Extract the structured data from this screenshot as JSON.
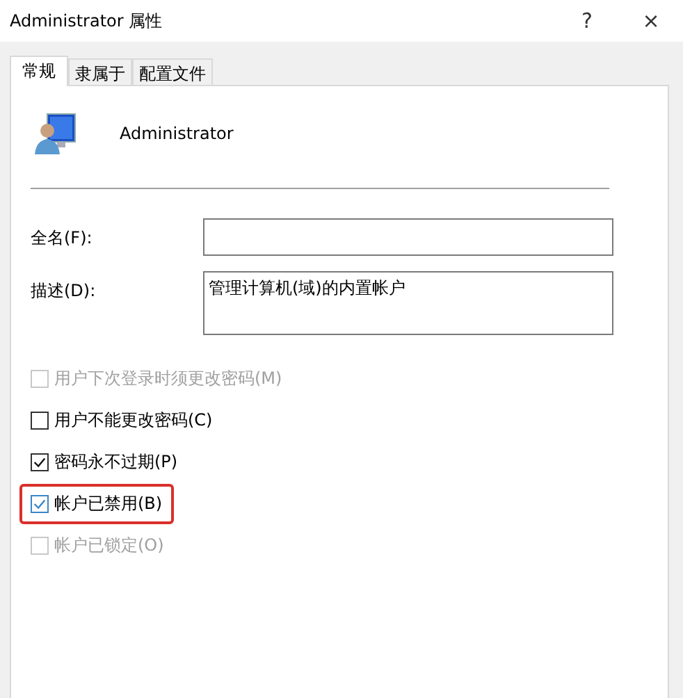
{
  "window": {
    "title": "Administrator 属性",
    "help": "?",
    "close": "×"
  },
  "tabs": [
    {
      "label": "常规",
      "selected": true
    },
    {
      "label": "隶属于",
      "selected": false
    },
    {
      "label": "配置文件",
      "selected": false
    }
  ],
  "user": {
    "name": "Administrator"
  },
  "fields": [
    {
      "label": "全名(F):",
      "multiline": false
    },
    {
      "label": "描述(D):",
      "value": "管理计算机(域)的内置帐户",
      "multiline": true
    }
  ],
  "options": [
    {
      "label": "用户下次登录时须更改密码(M)",
      "checked": false,
      "disabled": true,
      "highlighted": false
    },
    {
      "label": "用户不能更改密码(C)",
      "checked": false,
      "disabled": false,
      "highlighted": false
    },
    {
      "label": "密码永不过期(P)",
      "checked": true,
      "disabled": false,
      "highlighted": false
    },
    {
      "label": "帐户已禁用(B)",
      "checked": true,
      "disabled": false,
      "highlighted": true
    },
    {
      "label": "帐户已锁定(O)",
      "checked": false,
      "disabled": true,
      "highlighted": false
    }
  ]
}
